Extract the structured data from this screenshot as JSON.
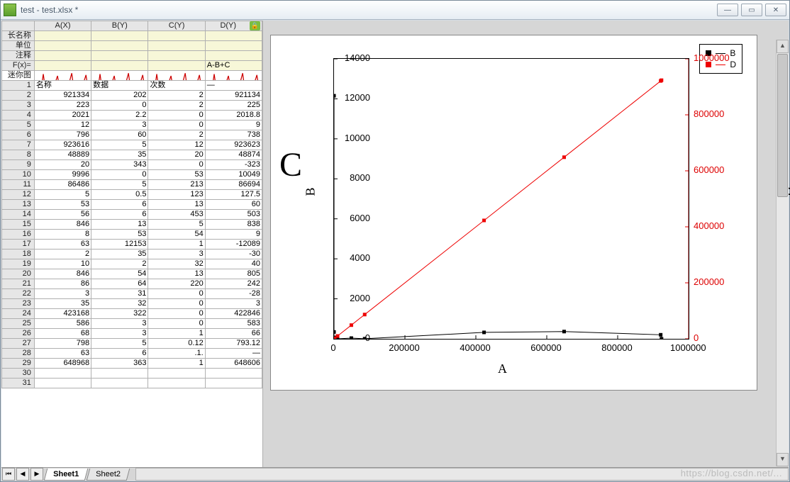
{
  "window": {
    "title": "test - test.xlsx *"
  },
  "columns": [
    "",
    "A(X)",
    "B(Y)",
    "C(Y)",
    "D(Y)"
  ],
  "header_rows_labels": [
    "长名称",
    "单位",
    "注释",
    "F(x)="
  ],
  "fx_row": [
    "",
    "",
    "",
    "A-B+C"
  ],
  "spark_label": "迷你图",
  "row1": [
    "名称",
    "数据",
    "次数",
    "—"
  ],
  "rows": [
    [
      "921334",
      "202",
      "2",
      "921134"
    ],
    [
      "223",
      "0",
      "2",
      "225"
    ],
    [
      "2021",
      "2.2",
      "0",
      "2018.8"
    ],
    [
      "12",
      "3",
      "0",
      "9"
    ],
    [
      "796",
      "60",
      "2",
      "738"
    ],
    [
      "923616",
      "5",
      "12",
      "923623"
    ],
    [
      "48889",
      "35",
      "20",
      "48874"
    ],
    [
      "20",
      "343",
      "0",
      "-323"
    ],
    [
      "9996",
      "0",
      "53",
      "10049"
    ],
    [
      "86486",
      "5",
      "213",
      "86694"
    ],
    [
      "5",
      "0.5",
      "123",
      "127.5"
    ],
    [
      "53",
      "6",
      "13",
      "60"
    ],
    [
      "56",
      "6",
      "453",
      "503"
    ],
    [
      "846",
      "13",
      "5",
      "838"
    ],
    [
      "8",
      "53",
      "54",
      "9"
    ],
    [
      "63",
      "12153",
      "1",
      "-12089"
    ],
    [
      "2",
      "35",
      "3",
      "-30"
    ],
    [
      "10",
      "2",
      "32",
      "40"
    ],
    [
      "846",
      "54",
      "13",
      "805"
    ],
    [
      "86",
      "64",
      "220",
      "242"
    ],
    [
      "3",
      "31",
      "0",
      "-28"
    ],
    [
      "35",
      "32",
      "0",
      "3"
    ],
    [
      "423168",
      "322",
      "0",
      "422846"
    ],
    [
      "586",
      "3",
      "0",
      "583"
    ],
    [
      "68",
      "3",
      "1",
      "66"
    ],
    [
      "798",
      "5",
      "0.12",
      "793.12"
    ],
    [
      "63",
      "6",
      ".1.",
      "—"
    ],
    [
      "648968",
      "363",
      "1",
      "648606"
    ],
    [
      "",
      "",
      "",
      ""
    ],
    [
      "",
      "",
      "",
      ""
    ]
  ],
  "tabs": {
    "active": "Sheet1",
    "inactive": "Sheet2"
  },
  "chart_data": {
    "type": "scatter-line",
    "xlabel": "A",
    "y1label": "B",
    "y2label": "D",
    "big_label": "C",
    "x_ticks": [
      "0",
      "200000",
      "400000",
      "600000",
      "800000",
      "1000000"
    ],
    "y1_ticks": [
      "0",
      "2000",
      "4000",
      "6000",
      "8000",
      "10000",
      "12000",
      "14000"
    ],
    "y2_ticks": [
      "0",
      "200000",
      "400000",
      "600000",
      "800000",
      "1000000"
    ],
    "x_range": [
      0,
      1000000
    ],
    "y1_range": [
      0,
      14000
    ],
    "y2_range": [
      0,
      1000000
    ],
    "series": [
      {
        "name": "B",
        "axis": "y1",
        "color": "#000",
        "points": [
          [
            2,
            35
          ],
          [
            3,
            31
          ],
          [
            5,
            0.5
          ],
          [
            8,
            53
          ],
          [
            10,
            2
          ],
          [
            12,
            3
          ],
          [
            20,
            343
          ],
          [
            35,
            32
          ],
          [
            53,
            6
          ],
          [
            56,
            6
          ],
          [
            63,
            6
          ],
          [
            63,
            12153
          ],
          [
            68,
            3
          ],
          [
            86,
            64
          ],
          [
            223,
            0
          ],
          [
            586,
            3
          ],
          [
            796,
            60
          ],
          [
            798,
            5
          ],
          [
            846,
            13
          ],
          [
            846,
            54
          ],
          [
            2021,
            2.2
          ],
          [
            9996,
            0
          ],
          [
            48889,
            35
          ],
          [
            86486,
            5
          ],
          [
            423168,
            322
          ],
          [
            648968,
            363
          ],
          [
            921334,
            202
          ],
          [
            923616,
            5
          ]
        ]
      },
      {
        "name": "D",
        "axis": "y2",
        "color": "#e00",
        "points": [
          [
            2,
            -30
          ],
          [
            3,
            -28
          ],
          [
            5,
            127.5
          ],
          [
            8,
            9
          ],
          [
            10,
            40
          ],
          [
            12,
            9
          ],
          [
            20,
            -323
          ],
          [
            35,
            3
          ],
          [
            53,
            60
          ],
          [
            56,
            503
          ],
          [
            63,
            -12089
          ],
          [
            68,
            66
          ],
          [
            86,
            242
          ],
          [
            223,
            225
          ],
          [
            586,
            583
          ],
          [
            796,
            738
          ],
          [
            798,
            793.12
          ],
          [
            846,
            805
          ],
          [
            846,
            838
          ],
          [
            2021,
            2018.8
          ],
          [
            9996,
            10049
          ],
          [
            48889,
            48874
          ],
          [
            86486,
            86694
          ],
          [
            423168,
            422846
          ],
          [
            648968,
            648606
          ],
          [
            921334,
            921134
          ],
          [
            923616,
            923623
          ]
        ]
      }
    ],
    "legend": [
      "B",
      "D"
    ]
  },
  "watermark": "https://blog.csdn.net/..."
}
